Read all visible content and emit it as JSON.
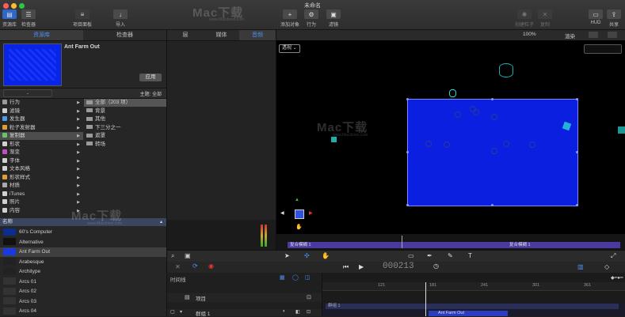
{
  "window": {
    "title": "未命名"
  },
  "toolbar": {
    "library_browser": "资源库",
    "inspector": "检查器",
    "project_panel": "项目面板",
    "import": "导入",
    "add_object": "添加对象",
    "behaviors": "行为",
    "filters": "滤镜",
    "make_particles": "创建粒子",
    "replicate": "复制",
    "hud": "HUD",
    "share": "共享"
  },
  "library_tabs": {
    "library": "资源库",
    "inspector": "检查器"
  },
  "preview": {
    "title": "Ant Farm Out",
    "apply_label": "应用"
  },
  "theme_filter": {
    "label": "主题: 全部"
  },
  "categories": [
    {
      "label": "行为",
      "icon": "gear-icon",
      "color": "#9a9a9a"
    },
    {
      "label": "滤镜",
      "icon": "filter-icon",
      "color": "#d0d0d0"
    },
    {
      "label": "发生器",
      "icon": "generator-icon",
      "color": "#4d9bf0"
    },
    {
      "label": "粒子发射器",
      "icon": "particle-icon",
      "color": "#e0a030"
    },
    {
      "label": "复制器",
      "icon": "replicator-icon",
      "color": "#6cc26c"
    },
    {
      "label": "形状",
      "icon": "shape-icon",
      "color": "#d0d0d0"
    },
    {
      "label": "渐变",
      "icon": "gradient-icon",
      "color": "#c050c0"
    },
    {
      "label": "字体",
      "icon": "font-icon",
      "color": "#d0d0d0"
    },
    {
      "label": "文本风格",
      "icon": "text-style-icon",
      "color": "#d0d0d0"
    },
    {
      "label": "形状样式",
      "icon": "shape-style-icon",
      "color": "#e0a030"
    },
    {
      "label": "材质",
      "icon": "material-icon",
      "color": "#aaaaaa"
    },
    {
      "label": "iTunes",
      "icon": "music-icon",
      "color": "#d0d0d0"
    },
    {
      "label": "照片",
      "icon": "photo-icon",
      "color": "#d0d0d0"
    },
    {
      "label": "内容",
      "icon": "content-icon",
      "color": "#d0d0d0"
    }
  ],
  "subcategories": [
    {
      "label": "全部（203 项）"
    },
    {
      "label": "背景"
    },
    {
      "label": "其他"
    },
    {
      "label": "下三分之一"
    },
    {
      "label": "遮罩"
    },
    {
      "label": "转场"
    }
  ],
  "name_header": "名称",
  "items": [
    {
      "label": "60's Computer",
      "thumb": "#0e2d8a"
    },
    {
      "label": "Alternative",
      "thumb": "#111111"
    },
    {
      "label": "Ant Farm Out",
      "thumb": "#1a3ae0"
    },
    {
      "label": "Arabesque",
      "thumb": "#222222"
    },
    {
      "label": "Architype",
      "thumb": "#222222"
    },
    {
      "label": "Arcs 01",
      "thumb": "#333333"
    },
    {
      "label": "Arcs 02",
      "thumb": "#333333"
    },
    {
      "label": "Arcs 03",
      "thumb": "#333333"
    },
    {
      "label": "Arcs 04",
      "thumb": "#333333"
    }
  ],
  "layer_tabs": {
    "layers": "层",
    "media": "媒体",
    "audio": "音频"
  },
  "canvas": {
    "zoom": "100%",
    "render": "渲染",
    "view_mode": "透视",
    "timeline_left": "复合模糊 1",
    "timeline_right": "复合模糊 1"
  },
  "timing": {
    "timecode": "000213",
    "timeline_label": "时间线"
  },
  "timeline": {
    "ruler_marks": [
      "121",
      "181",
      "241",
      "301",
      "361"
    ],
    "project_label": "项目",
    "group_label": "群组 1",
    "track_label": "群组 1",
    "clip_label": "Ant Farm Out"
  },
  "watermark": {
    "brand": "Mac下载",
    "url": "www.Macdown.com"
  }
}
